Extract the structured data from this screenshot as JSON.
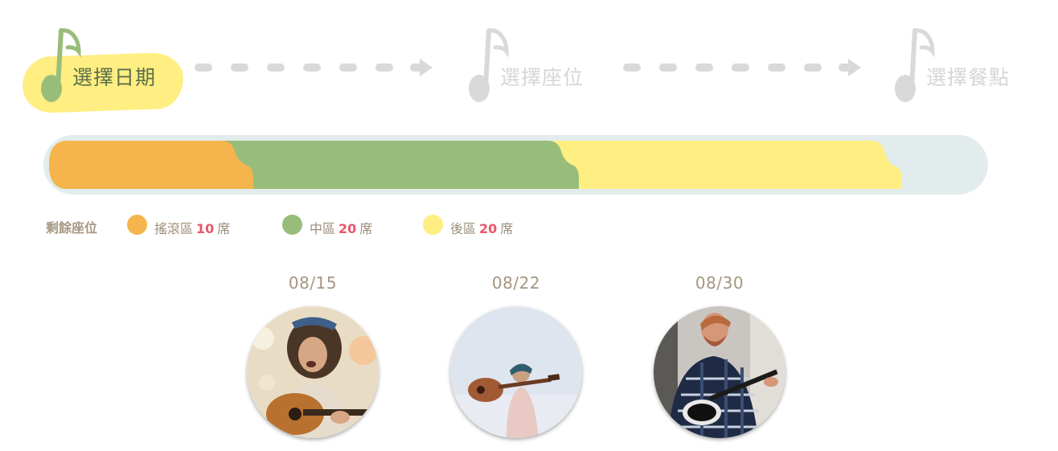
{
  "steps": [
    {
      "label": "選擇日期",
      "state": "active"
    },
    {
      "label": "選擇座位",
      "state": "inactive"
    },
    {
      "label": "選擇餐點",
      "state": "inactive"
    }
  ],
  "colors": {
    "active_note": "#98bd7a",
    "inactive": "#d9d9d9",
    "rock_zone": "#f5b54c",
    "middle_zone": "#98bd7a",
    "back_zone": "#ffee82",
    "bar_track": "#e2ecec",
    "count_highlight": "#e9566a"
  },
  "seats": {
    "title": "剩餘座位",
    "unit": "席",
    "zones": [
      {
        "name": "搖滾區",
        "count": "10"
      },
      {
        "name": "中區",
        "count": "20"
      },
      {
        "name": "後區",
        "count": "20"
      }
    ]
  },
  "dates": [
    {
      "label": "08/15",
      "photo": "musician-acoustic-guitar-headband"
    },
    {
      "label": "08/22",
      "photo": "woman-holding-guitar-over-shoulder"
    },
    {
      "label": "08/30",
      "photo": "man-playing-electric-guitar"
    }
  ]
}
